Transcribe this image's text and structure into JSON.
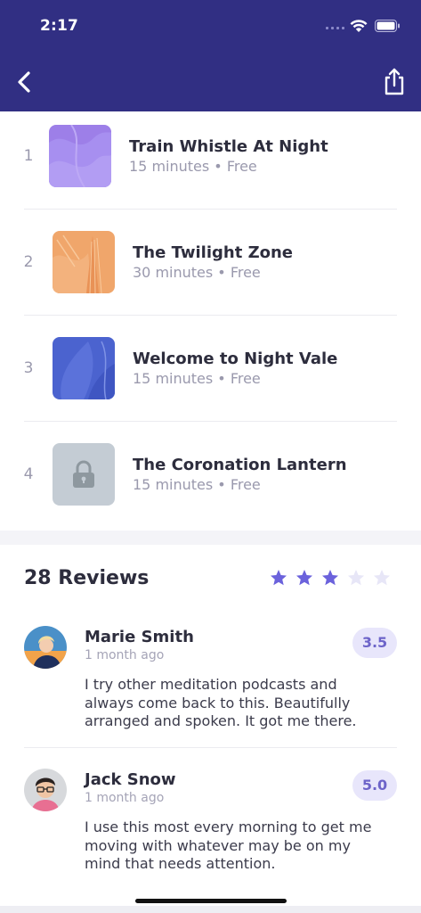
{
  "status_bar": {
    "time": "2:17"
  },
  "nav": {
    "back_icon": "chevron-left-icon",
    "share_icon": "share-icon"
  },
  "episodes": [
    {
      "number": "1",
      "title": "Train Whistle At Night",
      "meta": "15 minutes • Free",
      "locked": false,
      "color": "#9d7fe8"
    },
    {
      "number": "2",
      "title": "The Twilight Zone",
      "meta": "30 minutes • Free",
      "locked": false,
      "color": "#f0a66b"
    },
    {
      "number": "3",
      "title": "Welcome to Night Vale",
      "meta": "15 minutes • Free",
      "locked": false,
      "color": "#4b63cf"
    },
    {
      "number": "4",
      "title": "The Coronation Lantern",
      "meta": "15 minutes • Free",
      "locked": true,
      "color": "#c4ccd4"
    }
  ],
  "reviews": {
    "title": "28 Reviews",
    "rating": 3,
    "max_rating": 5,
    "star_color": "#6b62dc",
    "star_empty_color": "#e7e6f7",
    "items": [
      {
        "name": "Marie Smith",
        "time": "1 month ago",
        "rating": "3.5",
        "text": "I try other meditation podcasts and always come back to this. Beautifully arranged and spoken. It got me there."
      },
      {
        "name": "Jack Snow",
        "time": "1 month ago",
        "rating": "5.0",
        "text": "I use this most every morning to get me moving with whatever may be on my mind that needs attention."
      }
    ]
  },
  "colors": {
    "header": "#312f83",
    "accent": "#6d64c9"
  }
}
